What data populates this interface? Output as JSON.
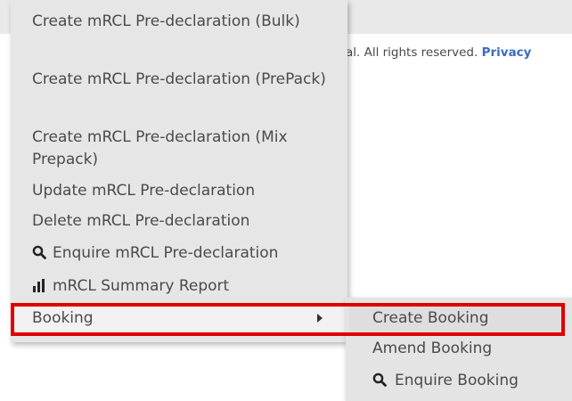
{
  "footer": {
    "text": "al. All rights reserved.",
    "privacy_label": "Privacy"
  },
  "menu": {
    "items": [
      {
        "label": "Create mRCL Pre-declaration (Bulk)"
      },
      {
        "label": "Create mRCL Pre-declaration (PrePack)"
      },
      {
        "label": "Create mRCL Pre-declaration (Mix Prepack)"
      },
      {
        "label": "Update mRCL Pre-declaration"
      },
      {
        "label": "Delete mRCL Pre-declaration"
      },
      {
        "label": "Enquire mRCL Pre-declaration",
        "icon": "search-icon"
      },
      {
        "label": "mRCL Summary Report",
        "icon": "bar-chart-icon"
      },
      {
        "label": "Booking",
        "icon": "chevron-right-icon"
      }
    ]
  },
  "submenu": {
    "items": [
      {
        "label": "Create Booking"
      },
      {
        "label": "Amend Booking"
      },
      {
        "label": "Enquire Booking",
        "icon": "search-icon"
      }
    ]
  },
  "colors": {
    "highlight_border": "#e00000",
    "link": "#3b6cc1",
    "menu_bg": "#e6e6e6"
  }
}
